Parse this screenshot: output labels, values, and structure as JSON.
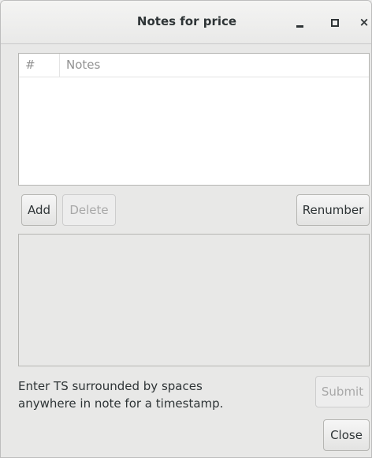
{
  "window": {
    "title": "Notes for price"
  },
  "notes_table": {
    "columns": [
      "#",
      "Notes"
    ],
    "rows": []
  },
  "buttons": {
    "add": "Add",
    "delete": "Delete",
    "renumber": "Renumber",
    "submit": "Submit",
    "close": "Close"
  },
  "note_editor": {
    "value": ""
  },
  "hint": {
    "line1": "Enter TS surrounded by spaces",
    "line2": "anywhere in note for a timestamp."
  },
  "state": {
    "delete_enabled": false,
    "submit_enabled": false
  }
}
